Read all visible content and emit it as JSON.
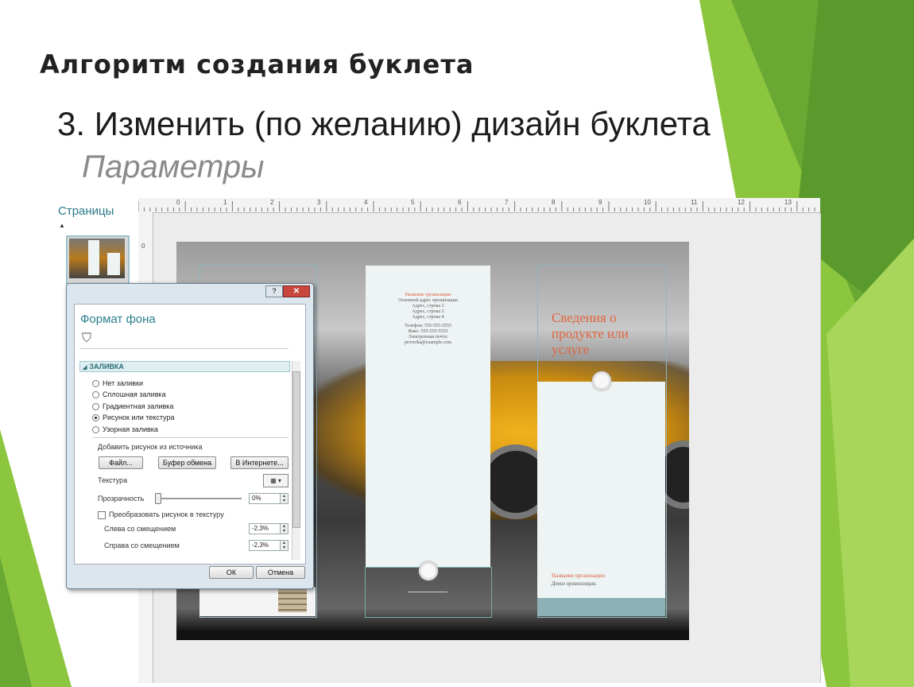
{
  "slide": {
    "title": "Алгоритм создания буклета",
    "step": "3. Изменить (по желанию) дизайн буклета",
    "subtitle": "Параметры"
  },
  "publisher": {
    "pages_label": "Страницы",
    "ruler_top_numbers": [
      "0",
      "1",
      "2",
      "3",
      "4",
      "5",
      "6",
      "7",
      "8",
      "9",
      "10",
      "11",
      "12",
      "13"
    ],
    "ruler_left_numbers": [
      "0"
    ],
    "brochure": {
      "middle_panel_lines": [
        "Название организации",
        "Основной адрес организации",
        "Адрес, строка 2",
        "Адрес, строка 3",
        "Адрес, строка 4",
        "Телефон: 555-555-5555",
        "Факс: 555-555-5555",
        "Электронная почта:",
        "proverka@example.com"
      ],
      "right_heading": "Сведения о продукте или услуге",
      "right_org": "Название организации",
      "right_motto": "Девиз организации."
    }
  },
  "dialog": {
    "help_glyph": "?",
    "close_glyph": "✕",
    "title": "Формат фона",
    "section": "ЗАЛИВКА",
    "fill_options": [
      {
        "label": "Нет заливки",
        "selected": false
      },
      {
        "label": "Сплошная заливка",
        "selected": false
      },
      {
        "label": "Градиентная заливка",
        "selected": false
      },
      {
        "label": "Рисунок или текстура",
        "selected": true
      },
      {
        "label": "Узорная заливка",
        "selected": false
      }
    ],
    "insert_from": "Добавить рисунок из источника",
    "btn_file": "Файл...",
    "btn_clipboard": "Буфер обмена",
    "btn_online": "В Интернете...",
    "texture_label": "Текстура",
    "transparency_label": "Прозрачность",
    "transparency_value": "0%",
    "tile_label": "Преобразовать рисунок в текстуру",
    "left_offset_label": "Слева со смещением",
    "left_offset_value": "-2,3%",
    "right_offset_label": "Справа со смещением",
    "right_offset_value": "-2,3%",
    "ok": "ОК",
    "cancel": "Отмена"
  },
  "colors": {
    "green_light": "#8cc63f",
    "green_dark": "#5a9a2c",
    "accent_teal": "#2a7f8a",
    "accent_orange": "#e0633c"
  }
}
